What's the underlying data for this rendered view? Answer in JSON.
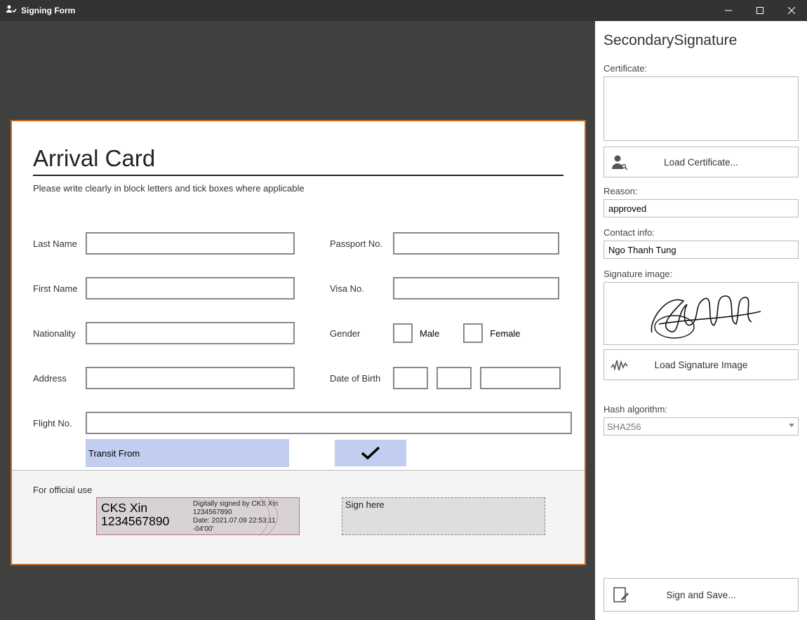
{
  "window": {
    "title": "Signing Form"
  },
  "document": {
    "title": "Arrival Card",
    "subtitle": "Please write clearly in block letters and tick boxes where applicable",
    "fields": {
      "last_name": {
        "label": "Last Name",
        "value": ""
      },
      "first_name": {
        "label": "First Name",
        "value": ""
      },
      "nationality": {
        "label": "Nationality",
        "value": ""
      },
      "address": {
        "label": "Address",
        "value": ""
      },
      "flight_no": {
        "label": "Flight No.",
        "value": ""
      },
      "passport_no": {
        "label": "Passport No.",
        "value": ""
      },
      "visa_no": {
        "label": "Visa No.",
        "value": ""
      },
      "gender": {
        "label": "Gender",
        "male": "Male",
        "female": "Female"
      },
      "dob": {
        "label": "Date of Birth"
      },
      "transit_from": {
        "label": "Transit  From"
      }
    },
    "footer": {
      "official_use": "For official use",
      "signature1": {
        "name": "CKS Xin",
        "number": "1234567890",
        "signed_by": "Digitally signed by CKS Xin",
        "id": "1234567890",
        "date": "Date: 2021.07.09 22:53:11 -04'00'"
      },
      "sign_here": "Sign here"
    }
  },
  "sidebar": {
    "title": "SecondarySignature",
    "certificate": {
      "label": "Certificate:",
      "value": ""
    },
    "load_cert_btn": "Load Certificate...",
    "reason": {
      "label": "Reason:",
      "value": "approved"
    },
    "contact": {
      "label": "Contact info:",
      "value": "Ngo Thanh Tung"
    },
    "sig_image": {
      "label": "Signature image:"
    },
    "load_sig_btn": "Load Signature Image",
    "hash": {
      "label": "Hash algorithm:",
      "selected": "SHA256"
    },
    "sign_save_btn": "Sign and Save..."
  }
}
